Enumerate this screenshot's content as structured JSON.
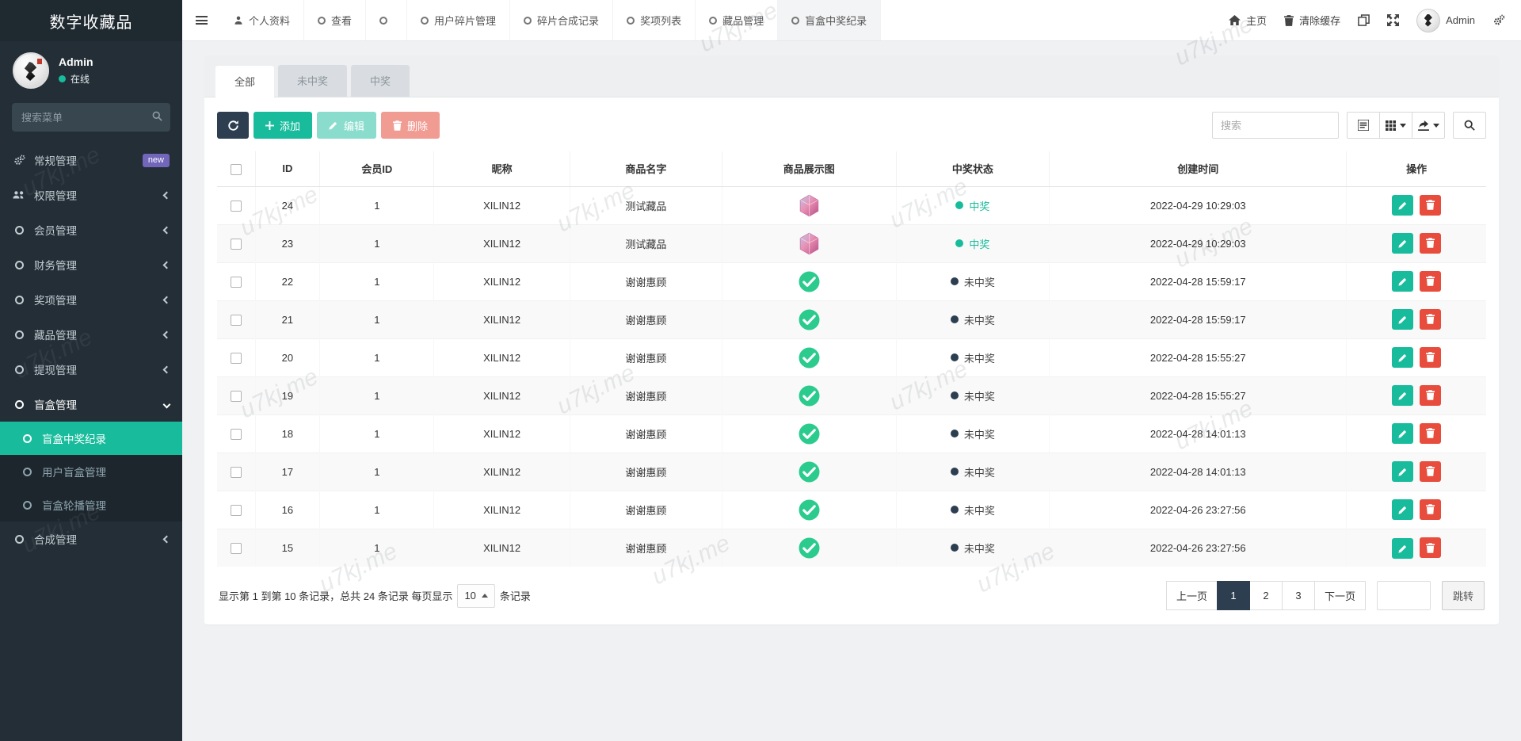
{
  "watermark": "u7kj.me",
  "colors": {
    "accent": "#18bc9c",
    "danger": "#e74c3c",
    "dark": "#2c3e50",
    "badge_purple": "#7266ba",
    "check_green": "#2bcb8e"
  },
  "sidebar": {
    "brand": "数字收藏品",
    "user": {
      "name": "Admin",
      "status": "在线"
    },
    "search_placeholder": "搜索菜单",
    "items": [
      {
        "label": "常规管理",
        "icon": "gears",
        "badge": "new"
      },
      {
        "label": "权限管理",
        "icon": "users",
        "chevron": "left"
      },
      {
        "label": "会员管理",
        "icon": "circle",
        "chevron": "left"
      },
      {
        "label": "财务管理",
        "icon": "circle",
        "chevron": "left"
      },
      {
        "label": "奖项管理",
        "icon": "circle",
        "chevron": "left"
      },
      {
        "label": "藏品管理",
        "icon": "circle",
        "chevron": "left"
      },
      {
        "label": "提现管理",
        "icon": "circle",
        "chevron": "left"
      },
      {
        "label": "盲盒管理",
        "icon": "circle",
        "chevron": "down",
        "class": "open"
      },
      {
        "label": "盲盒中奖纪录",
        "icon": "circle",
        "class": "submenu active"
      },
      {
        "label": "用户盲盒管理",
        "icon": "circle",
        "class": "submenu"
      },
      {
        "label": "盲盒轮播管理",
        "icon": "circle",
        "class": "submenu"
      },
      {
        "label": "合成管理",
        "icon": "circle",
        "chevron": "left"
      }
    ]
  },
  "topnav": {
    "tabs": [
      {
        "label": "个人资料",
        "icon": "person"
      },
      {
        "label": "查看",
        "icon": "circle"
      },
      {
        "label": "",
        "icon": "circle"
      },
      {
        "label": "用户碎片管理",
        "icon": "circle"
      },
      {
        "label": "碎片合成记录",
        "icon": "circle"
      },
      {
        "label": "奖项列表",
        "icon": "circle"
      },
      {
        "label": "藏品管理",
        "icon": "circle"
      },
      {
        "label": "盲盒中奖纪录",
        "icon": "circle",
        "class": "active"
      }
    ],
    "right": {
      "home": "主页",
      "clear_cache": "清除缓存",
      "admin": "Admin"
    }
  },
  "panel": {
    "filter_tabs": [
      {
        "label": "全部",
        "class": "active"
      },
      {
        "label": "未中奖"
      },
      {
        "label": "中奖"
      }
    ],
    "toolbar": {
      "add": "添加",
      "edit": "编辑",
      "del": "删除",
      "search_placeholder": "搜索"
    },
    "table": {
      "headers": [
        "ID",
        "会员ID",
        "昵称",
        "商品名字",
        "商品展示图",
        "中奖状态",
        "创建时间",
        "操作"
      ],
      "rows": [
        {
          "id": "24",
          "member_id": "1",
          "nickname": "XILIN12",
          "product": "测试藏品",
          "img": "gem",
          "status": "中奖",
          "status_class": "win",
          "time": "2022-04-29 10:29:03"
        },
        {
          "id": "23",
          "member_id": "1",
          "nickname": "XILIN12",
          "product": "测试藏品",
          "img": "gem",
          "status": "中奖",
          "status_class": "win",
          "time": "2022-04-29 10:29:03"
        },
        {
          "id": "22",
          "member_id": "1",
          "nickname": "XILIN12",
          "product": "谢谢惠顾",
          "img": "check",
          "status": "未中奖",
          "status_class": "lose",
          "time": "2022-04-28 15:59:17"
        },
        {
          "id": "21",
          "member_id": "1",
          "nickname": "XILIN12",
          "product": "谢谢惠顾",
          "img": "check",
          "status": "未中奖",
          "status_class": "lose",
          "time": "2022-04-28 15:59:17"
        },
        {
          "id": "20",
          "member_id": "1",
          "nickname": "XILIN12",
          "product": "谢谢惠顾",
          "img": "check",
          "status": "未中奖",
          "status_class": "lose",
          "time": "2022-04-28 15:55:27"
        },
        {
          "id": "19",
          "member_id": "1",
          "nickname": "XILIN12",
          "product": "谢谢惠顾",
          "img": "check",
          "status": "未中奖",
          "status_class": "lose",
          "time": "2022-04-28 15:55:27"
        },
        {
          "id": "18",
          "member_id": "1",
          "nickname": "XILIN12",
          "product": "谢谢惠顾",
          "img": "check",
          "status": "未中奖",
          "status_class": "lose",
          "time": "2022-04-28 14:01:13"
        },
        {
          "id": "17",
          "member_id": "1",
          "nickname": "XILIN12",
          "product": "谢谢惠顾",
          "img": "check",
          "status": "未中奖",
          "status_class": "lose",
          "time": "2022-04-28 14:01:13"
        },
        {
          "id": "16",
          "member_id": "1",
          "nickname": "XILIN12",
          "product": "谢谢惠顾",
          "img": "check",
          "status": "未中奖",
          "status_class": "lose",
          "time": "2022-04-26 23:27:56"
        },
        {
          "id": "15",
          "member_id": "1",
          "nickname": "XILIN12",
          "product": "谢谢惠顾",
          "img": "check",
          "status": "未中奖",
          "status_class": "lose",
          "time": "2022-04-26 23:27:56"
        }
      ]
    },
    "footer": {
      "summary_prefix": "显示第 1 到第 10 条记录，总共 24 条记录 每页显示",
      "per_page": "10",
      "summary_suffix": "条记录",
      "pages": [
        {
          "label": "上一页"
        },
        {
          "label": "1",
          "class": "active"
        },
        {
          "label": "2"
        },
        {
          "label": "3"
        },
        {
          "label": "下一页"
        }
      ],
      "jump": "跳转"
    }
  }
}
